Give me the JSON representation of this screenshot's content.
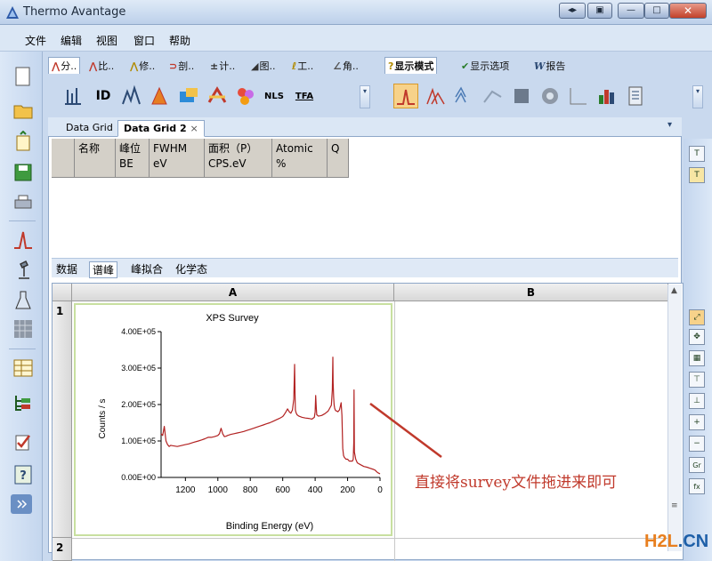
{
  "window": {
    "title": "Thermo Avantage"
  },
  "menu": [
    "文件",
    "编辑",
    "视图",
    "窗口",
    "帮助"
  ],
  "ribbon_tabs": [
    {
      "label": "分.."
    },
    {
      "label": "比.."
    },
    {
      "label": "修.."
    },
    {
      "label": "剖.."
    },
    {
      "label": "计.."
    },
    {
      "label": "图.."
    },
    {
      "label": "工.."
    },
    {
      "label": "角.."
    },
    {
      "label": "显示模式"
    },
    {
      "label": "显示选项"
    },
    {
      "label": "报告"
    }
  ],
  "toolbar_labels": {
    "id": "ID",
    "nls": "NLS",
    "tfa": "TFA"
  },
  "doc_tabs": [
    {
      "label": "Data Grid"
    },
    {
      "label": "Data Grid 2"
    }
  ],
  "doc_tab_close": "×",
  "peak_table_headers": [
    {
      "line1": "名称",
      "line2": ""
    },
    {
      "line1": "峰位",
      "line2": "BE"
    },
    {
      "line1": "FWHM",
      "line2": "eV"
    },
    {
      "line1": "面积（P）",
      "line2": "CPS.eV"
    },
    {
      "line1": "Atomic",
      "line2": "%"
    },
    {
      "line1": "Q",
      "line2": ""
    }
  ],
  "sub_tabs": [
    "数据",
    "谱峰",
    "峰拟合",
    "化学态"
  ],
  "sheet": {
    "columns": [
      "A",
      "B"
    ],
    "rows": [
      "1",
      "2"
    ]
  },
  "chart_data": {
    "type": "line",
    "title": "XPS Survey",
    "xlabel": "Binding Energy (eV)",
    "ylabel": "Counts / s",
    "xlim": [
      1350,
      0
    ],
    "ylim": [
      0,
      400000
    ],
    "xticks": [
      "1200",
      "1000",
      "800",
      "600",
      "400",
      "200",
      "0"
    ],
    "yticks": [
      "0.00E+00",
      "1.00E+05",
      "2.00E+05",
      "3.00E+05",
      "4.00E+05"
    ],
    "series": [
      {
        "color": "#b22222",
        "x": [
          1350,
          1340,
          1330,
          1320,
          1310,
          1300,
          1290,
          1280,
          1250,
          1220,
          1200,
          1180,
          1150,
          1120,
          1100,
          1080,
          1060,
          1040,
          1020,
          1000,
          990,
          980,
          970,
          960,
          950,
          940,
          920,
          900,
          880,
          860,
          840,
          820,
          800,
          780,
          760,
          740,
          720,
          700,
          680,
          660,
          640,
          620,
          600,
          590,
          580,
          570,
          560,
          550,
          540,
          532,
          527,
          524,
          522,
          518,
          512,
          500,
          480,
          460,
          440,
          420,
          405,
          400,
          397,
          393,
          390,
          380,
          360,
          340,
          320,
          310,
          300,
          294,
          291,
          289,
          286,
          283,
          280,
          276,
          272,
          265,
          260,
          250,
          245,
          240,
          235,
          230,
          225,
          220,
          210,
          200,
          190,
          170,
          165,
          162,
          160,
          158,
          150,
          140,
          120,
          100,
          80,
          60,
          40,
          30,
          20,
          10,
          0
        ],
        "y": [
          120000,
          115000,
          140000,
          100000,
          90000,
          85000,
          88000,
          87000,
          85000,
          88000,
          90000,
          92000,
          96000,
          100000,
          103000,
          106000,
          110000,
          110000,
          112000,
          115000,
          120000,
          135000,
          120000,
          112000,
          113000,
          115000,
          118000,
          120000,
          122000,
          124000,
          126000,
          129000,
          132000,
          135000,
          138000,
          141000,
          144000,
          147000,
          150000,
          154000,
          158000,
          162000,
          167000,
          173000,
          180000,
          188000,
          180000,
          176000,
          185000,
          215000,
          310000,
          230000,
          185000,
          178000,
          172000,
          168000,
          165000,
          163000,
          162000,
          160000,
          165000,
          180000,
          225000,
          190000,
          172000,
          168000,
          170000,
          175000,
          182000,
          190000,
          198000,
          240000,
          330000,
          260000,
          220000,
          200000,
          190000,
          185000,
          183000,
          182000,
          180000,
          185000,
          195000,
          205000,
          170000,
          80000,
          60000,
          55000,
          50000,
          50000,
          45000,
          45000,
          50000,
          95000,
          240000,
          70000,
          50000,
          40000,
          35000,
          30000,
          28000,
          25000,
          22000,
          20000,
          15000,
          12000,
          10000
        ]
      }
    ]
  },
  "annotation": "直接将survey文件拖进来即可",
  "watermark": {
    "main": "H2L",
    "suffix": ".CN"
  }
}
